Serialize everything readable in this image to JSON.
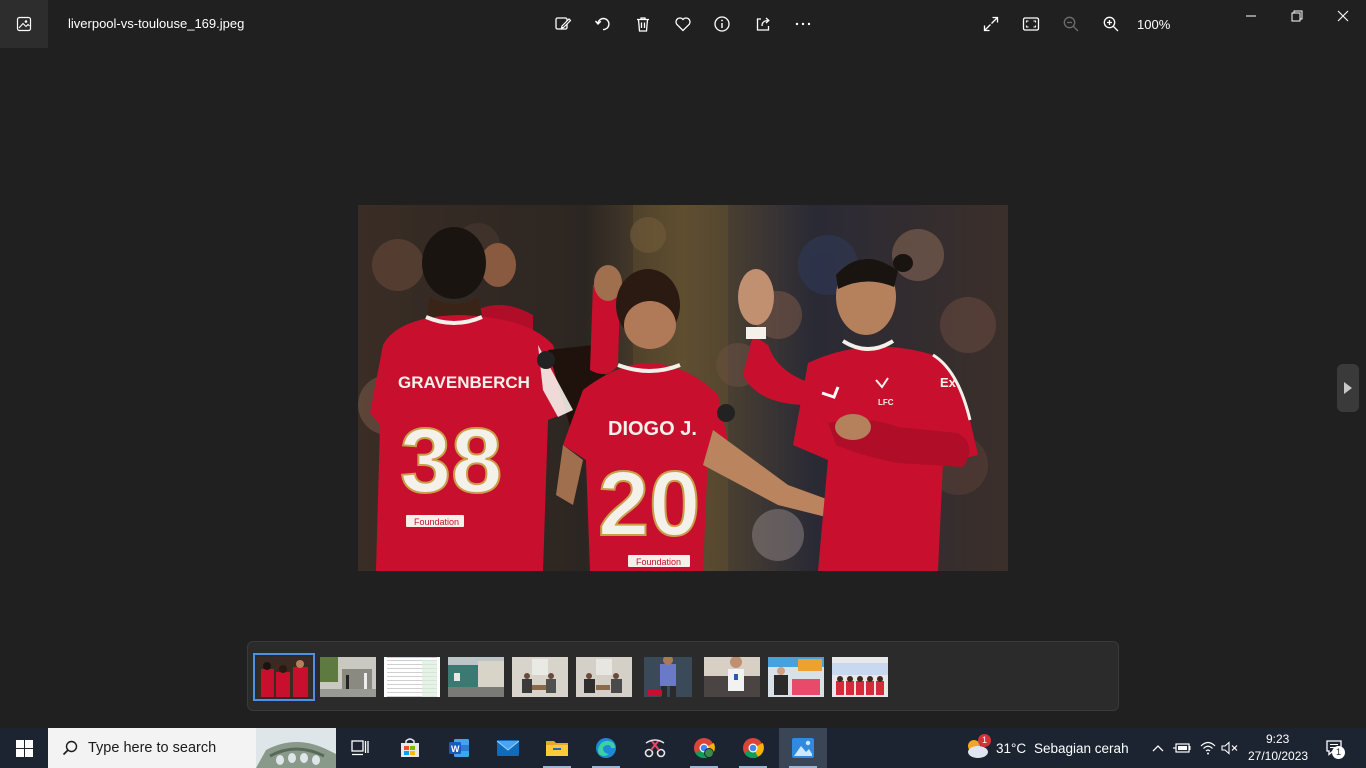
{
  "window": {
    "filename": "liverpool-vs-toulouse_169.jpeg",
    "zoom": "100%"
  },
  "toolbar": {
    "icons": [
      "edit-image-icon",
      "rotate-icon",
      "delete-icon",
      "favorite-icon",
      "info-icon",
      "share-icon",
      "more-icon"
    ],
    "right_icons": [
      "fullscreen-icon",
      "fit-to-window-icon",
      "zoom-out-icon",
      "zoom-in-icon"
    ]
  },
  "photo": {
    "player1_name": "GRAVENBERCH",
    "player1_number": "38",
    "player2_name": "DIOGO J.",
    "player2_number": "20",
    "sponsor_text": "Foundation",
    "crest_text": "LFC",
    "chest_text": "Ex",
    "colors": {
      "kit_red": "#c8102e",
      "kit_white": "#f4f1ea",
      "crowd": "#2a2320"
    }
  },
  "filmstrip": {
    "selected_index": 0,
    "thumbnail_count": 10
  },
  "taskbar": {
    "search_placeholder": "Type here to search",
    "apps": [
      "task-view-icon",
      "microsoft-store-icon",
      "word-icon",
      "mail-icon",
      "file-explorer-icon",
      "edge-icon",
      "snipping-tool-icon",
      "chrome-icon",
      "chrome-icon",
      "photos-icon"
    ],
    "weather": {
      "temperature": "31°C",
      "condition": "Sebagian cerah",
      "badge": "1"
    },
    "clock": {
      "time": "9:23",
      "date": "27/10/2023"
    },
    "notifications_count": "1"
  }
}
